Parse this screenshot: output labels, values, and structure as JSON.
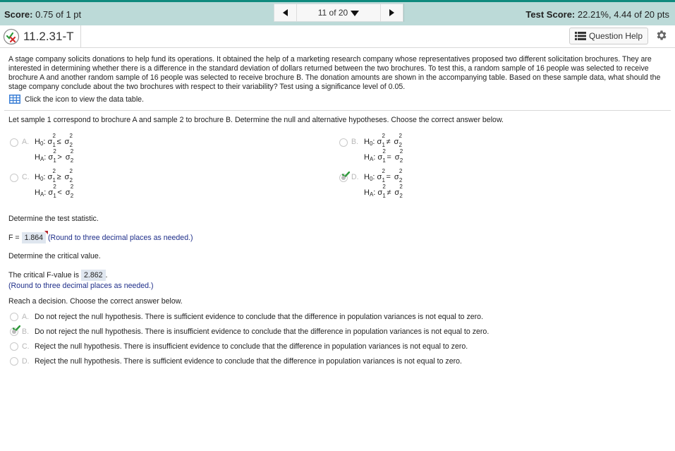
{
  "scorebar": {
    "score_label": "Score:",
    "score_value": "0.75 of 1 pt",
    "nav_position": "11 of 20",
    "test_score_label": "Test Score:",
    "test_score_value": "22.21%, 4.44 of 20 pts",
    "colors": {
      "bar": "#bcdad8",
      "accent": "#0f8a7e"
    }
  },
  "question": {
    "id": "11.2.31-T",
    "status_icon": "partial-credit-icon",
    "help_label": "Question Help"
  },
  "problem_text": "A stage company solicits donations to help fund its operations. It obtained the help of a marketing research company whose representatives proposed two different solicitation brochures. They are interested in determining whether there is a difference in the standard deviation of dollars returned between the two brochures. To test this, a random sample of 16 people was selected to receive brochure A and another random sample of 16 people was selected to receive brochure B. The donation amounts are shown in the accompanying table. Based on these sample data, what should the stage company conclude about the two brochures with respect to their variability? Test using a significance level of 0.05.",
  "data_table_link": "Click the icon to view the data table.",
  "part1": {
    "prompt": "Let sample 1 correspond to brochure A and sample 2 to brochure B. Determine the null and alternative hypotheses. Choose the correct answer below.",
    "options": [
      {
        "letter": "A.",
        "h0_op": "≤",
        "ha_op": ">",
        "selected": false
      },
      {
        "letter": "B.",
        "h0_op": "≠",
        "ha_op": "=",
        "selected": false
      },
      {
        "letter": "C.",
        "h0_op": "≥",
        "ha_op": "<",
        "selected": false
      },
      {
        "letter": "D.",
        "h0_op": "=",
        "ha_op": "≠",
        "selected": true,
        "correct": true
      }
    ],
    "h0": "H",
    "h0_sub": "0",
    "ha": "H",
    "ha_sub": "A",
    "colon": ":",
    "sigma": "σ",
    "sup": "2",
    "sub1": "1",
    "sub2": "2"
  },
  "part2": {
    "prompt": "Determine the test statistic.",
    "label": "F =",
    "value": "1.864",
    "note": "(Round to three decimal places as needed.)"
  },
  "part3": {
    "prompt": "Determine the critical value.",
    "label": "The critical F-value is",
    "value": "2.862",
    "period": ".",
    "note": "(Round to three decimal places as needed.)"
  },
  "part4": {
    "prompt": "Reach a decision. Choose the correct answer below.",
    "options": [
      {
        "letter": "A.",
        "text": "Do not reject the null hypothesis. There is sufficient evidence to conclude that the difference in population variances is not equal to zero.",
        "selected": false
      },
      {
        "letter": "B.",
        "text": "Do not reject the null hypothesis. There is insufficient evidence to conclude that the difference in population variances is not equal to zero.",
        "selected": true,
        "correct": true
      },
      {
        "letter": "C.",
        "text": "Reject the null hypothesis. There is insufficient evidence to conclude that the difference in population variances is not equal to zero.",
        "selected": false
      },
      {
        "letter": "D.",
        "text": "Reject the null hypothesis. There is sufficient evidence to conclude that the difference in population variances is not equal to zero.",
        "selected": false
      }
    ]
  }
}
